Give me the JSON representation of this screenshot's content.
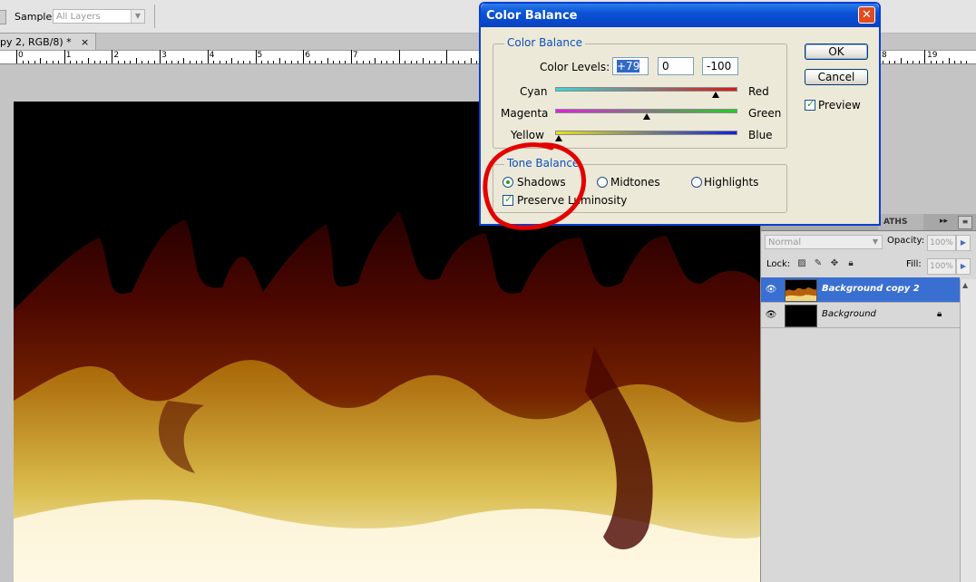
{
  "options_bar": {
    "sample_label": "Sample:",
    "sample_value": "All Layers"
  },
  "document_tab": {
    "title": "py 2, RGB/8) *",
    "close_glyph": "×"
  },
  "ruler": {
    "labels": [
      "0",
      "1",
      "2",
      "3",
      "4",
      "5",
      "6",
      "7",
      "8",
      "19"
    ]
  },
  "dialog": {
    "title": "Color Balance",
    "close_glyph": "✕",
    "color_balance": {
      "legend": "Color Balance",
      "levels_label": "Color Levels:",
      "levels": [
        "+79",
        "0",
        "-100"
      ],
      "sliders": [
        {
          "left": "Cyan",
          "right": "Red",
          "value": 79,
          "colors": [
            "#3ad6d6",
            "#d81818"
          ]
        },
        {
          "left": "Magenta",
          "right": "Green",
          "value": 0,
          "colors": [
            "#e020e0",
            "#22d022"
          ]
        },
        {
          "left": "Yellow",
          "right": "Blue",
          "value": -100,
          "colors": [
            "#e8e418",
            "#1020d8"
          ]
        }
      ]
    },
    "tone_balance": {
      "legend": "Tone Balance",
      "options": [
        "Shadows",
        "Midtones",
        "Highlights"
      ],
      "selected": "Shadows",
      "preserve_label": "Preserve Luminosity",
      "preserve_checked": true
    },
    "ok_label": "OK",
    "cancel_label": "Cancel",
    "preview_label": "Preview",
    "preview_checked": true
  },
  "layers_panel": {
    "tab_label": "ATHS",
    "double_arrow": "▸▸",
    "menu_glyph": "≡",
    "blend_mode": "Normal",
    "opacity_label": "Opacity:",
    "opacity_value": "100%",
    "lock_label": "Lock:",
    "fill_label": "Fill:",
    "fill_value": "100%",
    "layers": [
      {
        "name": "Background copy 2",
        "selected": true
      },
      {
        "name": "Background",
        "selected": false,
        "locked": true
      }
    ]
  },
  "colors": {
    "selection_blue": "#3a6fd2",
    "annotation_red": "#e30000",
    "dialog_title_blue": "#0a52d6"
  }
}
